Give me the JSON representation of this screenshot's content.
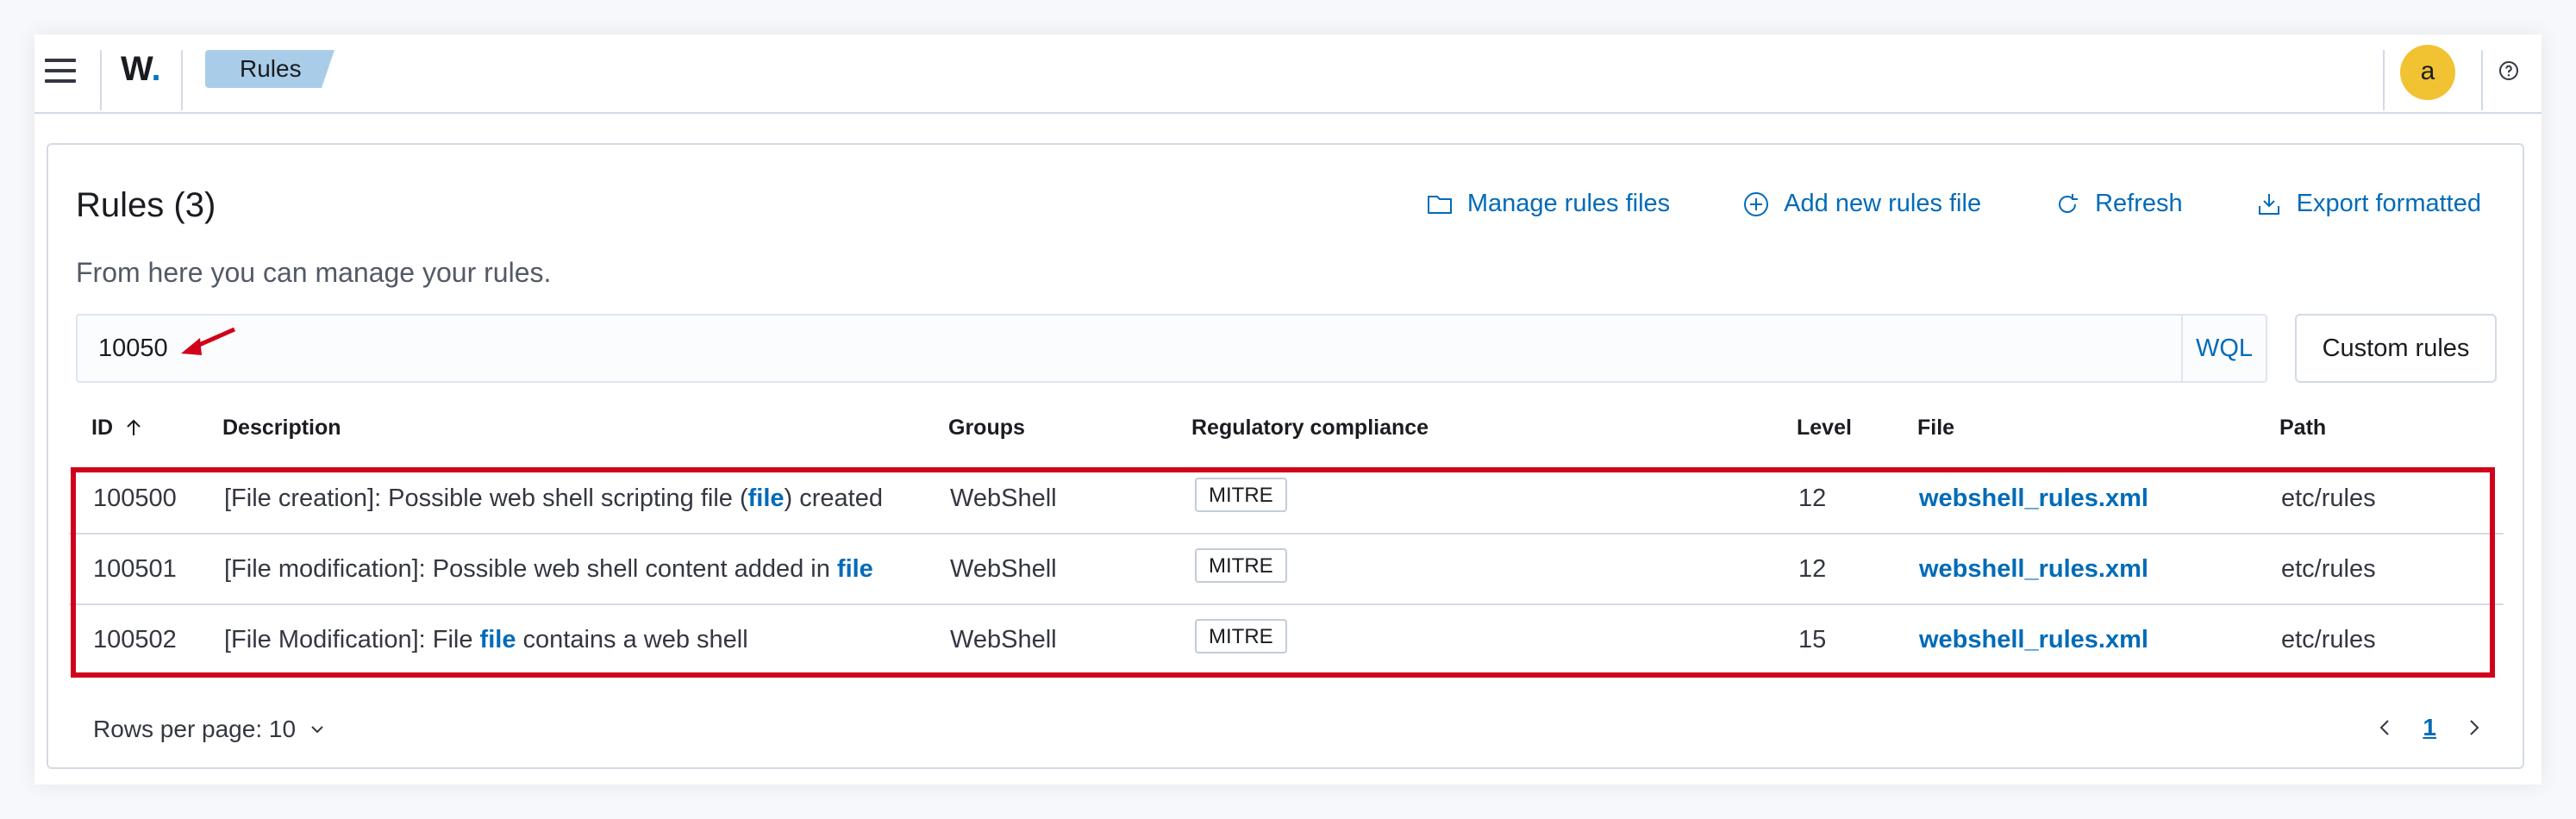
{
  "header": {
    "logo_text": "W",
    "logo_dot": ".",
    "breadcrumb": "Rules",
    "avatar_letter": "a"
  },
  "page": {
    "title": "Rules (3)",
    "subtitle": "From here you can manage your rules."
  },
  "actions": [
    {
      "label": "Manage rules files",
      "icon": "folder-icon"
    },
    {
      "label": "Add new rules file",
      "icon": "plus-circle-icon"
    },
    {
      "label": "Refresh",
      "icon": "refresh-icon"
    },
    {
      "label": "Export formatted",
      "icon": "export-icon"
    }
  ],
  "search": {
    "value": "10050",
    "wql_label": "WQL"
  },
  "custom_rules_label": "Custom rules",
  "table": {
    "columns": [
      "ID",
      "Description",
      "Groups",
      "Regulatory compliance",
      "Level",
      "File",
      "Path"
    ],
    "rows": [
      {
        "id": "100500",
        "desc_before": "[File creation]: Possible web shell scripting file (",
        "desc_link": "file",
        "desc_after": ") created",
        "group": "WebShell",
        "compliance": "MITRE",
        "level": "12",
        "file": "webshell_rules.xml",
        "path": "etc/rules"
      },
      {
        "id": "100501",
        "desc_before": "[File modification]: Possible web shell content added in ",
        "desc_link": "file",
        "desc_after": "",
        "group": "WebShell",
        "compliance": "MITRE",
        "level": "12",
        "file": "webshell_rules.xml",
        "path": "etc/rules"
      },
      {
        "id": "100502",
        "desc_before": "[File Modification]: File ",
        "desc_link": "file",
        "desc_after": " contains a web shell",
        "group": "WebShell",
        "compliance": "MITRE",
        "level": "15",
        "file": "webshell_rules.xml",
        "path": "etc/rules"
      }
    ]
  },
  "pagination": {
    "rows_per_page_label": "Rows per page: 10",
    "current_page": "1"
  },
  "colors": {
    "accent": "#006bb8",
    "highlight": "#d0021b",
    "avatar": "#f1c232",
    "breadcrumb": "#a9cde8"
  }
}
